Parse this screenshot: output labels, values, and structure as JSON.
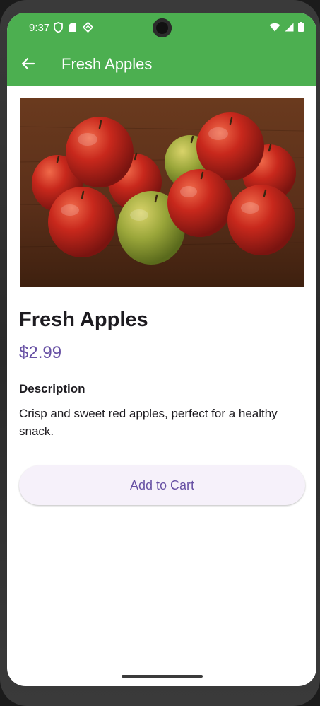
{
  "status_bar": {
    "time": "9:37"
  },
  "app_bar": {
    "title": "Fresh Apples"
  },
  "product": {
    "name": "Fresh Apples",
    "price": "$2.99",
    "description_heading": "Description",
    "description": "Crisp and sweet red apples, perfect for a healthy snack.",
    "add_to_cart_label": "Add to Cart"
  },
  "colors": {
    "app_bar": "#4caf50",
    "accent": "#6750a4",
    "button_bg": "#f6f1fa"
  },
  "icons": {
    "back": "arrow-back-icon",
    "status": [
      "shield-icon",
      "sd-card-icon",
      "location-diamond-icon",
      "wifi-icon",
      "signal-icon",
      "battery-icon"
    ]
  }
}
